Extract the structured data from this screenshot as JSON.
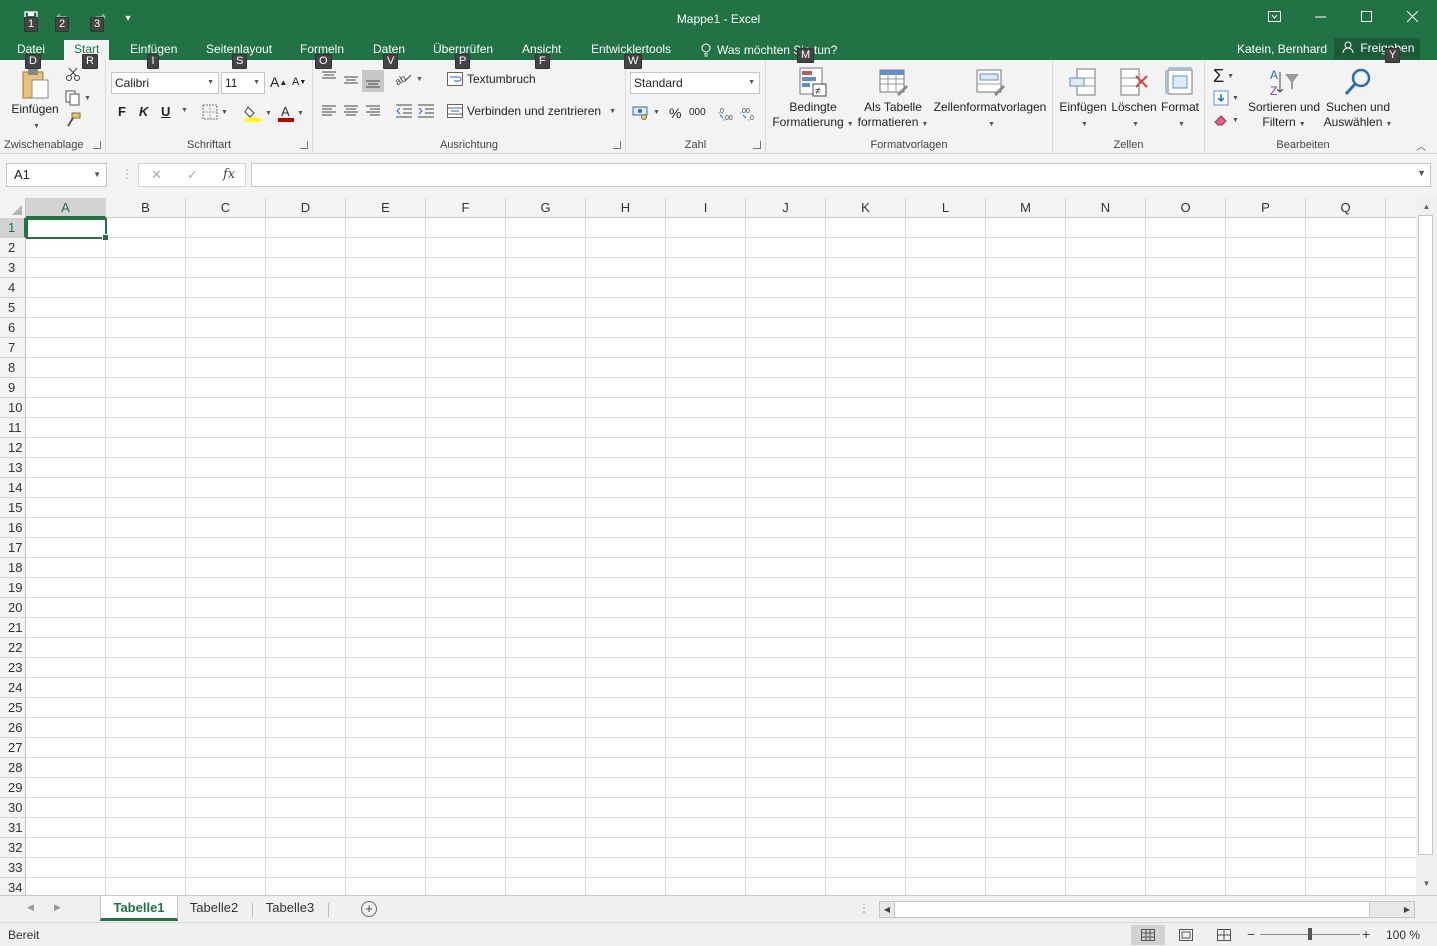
{
  "window": {
    "title": "Mappe1 - Excel",
    "restore_icon": "ribbon-display-icon",
    "minimize_icon": "minimize-icon",
    "maximize_icon": "maximize-icon",
    "close_icon": "close-icon"
  },
  "quick_access": {
    "keytips": [
      "1",
      "2",
      "3"
    ],
    "customize_glyph": "▾"
  },
  "tabs": {
    "datei": "Datei",
    "start": "Start",
    "einfuegen": "Einfügen",
    "seitenlayout": "Seitenlayout",
    "formeln": "Formeln",
    "daten": "Daten",
    "ueberpruefen": "Überprüfen",
    "ansicht": "Ansicht",
    "entwicklertools": "Entwicklertools",
    "tellme": "Was möchten Sie tun?",
    "user": "Katein, Bernhard",
    "share": "Freigeben"
  },
  "keytips": {
    "datei": "D",
    "start": "R",
    "einfuegen": "I",
    "seitenlayout": "S",
    "formeln": "O",
    "daten": "V",
    "ueberpruefen": "P",
    "ansicht": "F",
    "entwicklertools": "W",
    "tellme": "M",
    "share": "Y"
  },
  "ribbon": {
    "clipboard": {
      "label": "Zwischenablage",
      "paste": "Einfügen"
    },
    "font": {
      "label": "Schriftart",
      "name": "Calibri",
      "size": "11",
      "bold": "F",
      "italic": "K",
      "underline": "U"
    },
    "alignment": {
      "label": "Ausrichtung",
      "wrap": "Textumbruch",
      "merge": "Verbinden und zentrieren"
    },
    "number": {
      "label": "Zahl",
      "format": "Standard",
      "percent": "%",
      "thousands": "000"
    },
    "styles": {
      "label": "Formatvorlagen",
      "conditional_1": "Bedingte",
      "conditional_2": "Formatierung",
      "table_1": "Als Tabelle",
      "table_2": "formatieren",
      "cellstyles": "Zellenformatvorlagen"
    },
    "cells": {
      "label": "Zellen",
      "insert": "Einfügen",
      "delete": "Löschen",
      "format": "Format"
    },
    "editing": {
      "label": "Bearbeiten",
      "sort_1": "Sortieren und",
      "sort_2": "Filtern",
      "find_1": "Suchen und",
      "find_2": "Auswählen"
    }
  },
  "formula_bar": {
    "namebox": "A1",
    "fx": "fx",
    "cancel": "✕",
    "enter": "✓",
    "value": ""
  },
  "columns": [
    "A",
    "B",
    "C",
    "D",
    "E",
    "F",
    "G",
    "H",
    "I",
    "J",
    "K",
    "L",
    "M",
    "N",
    "O",
    "P",
    "Q"
  ],
  "rows": [
    "1",
    "2",
    "3",
    "4",
    "5",
    "6",
    "7",
    "8",
    "9",
    "10",
    "11",
    "12",
    "13",
    "14",
    "15",
    "16",
    "17",
    "18",
    "19",
    "20",
    "21",
    "22",
    "23",
    "24",
    "25",
    "26",
    "27",
    "28",
    "29",
    "30",
    "31",
    "32",
    "33",
    "34"
  ],
  "selection": {
    "column": "A",
    "row": "1"
  },
  "sheets": [
    "Tabelle1",
    "Tabelle2",
    "Tabelle3"
  ],
  "active_sheet": "Tabelle1",
  "status": {
    "mode": "Bereit",
    "zoom": "100 %",
    "zoom_percent": 100
  },
  "colors": {
    "accent": "#217346",
    "ribbon_bg": "#f3f3f3",
    "gridline": "#dadada",
    "font_color": "#c00000",
    "fill_color": "#ffff00"
  }
}
